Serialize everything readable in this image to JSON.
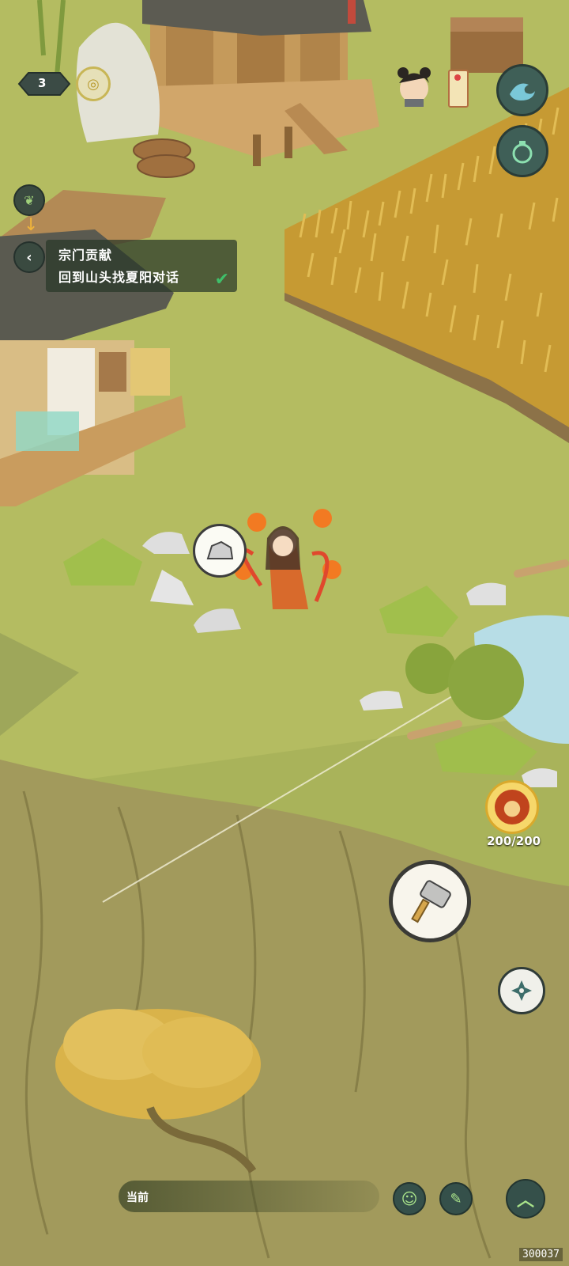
{
  "hud": {
    "level": "3",
    "stamina": "200/200"
  },
  "quest": {
    "title": "宗门贡献",
    "description": "回到山头找夏阳对话"
  },
  "chat": {
    "channel": "当前"
  },
  "version": "300037",
  "colors": {
    "grass": "#a9b35a",
    "cliff": "#a29a5c",
    "wheat": "#d2a73d",
    "water": "#b7dde6",
    "ui_dark": "#2e3b33",
    "ui_teal": "#3f8c86",
    "check": "#3fbf6a"
  },
  "icons": {
    "back": "chevron-left-icon",
    "wave": "wave-skill-icon",
    "pot": "gourd-icon",
    "map": "scroll-icon",
    "hammer": "hammer-tool-icon",
    "dodge": "shuriken-icon",
    "emoji": "smile-icon",
    "quick": "quick-chat-icon",
    "expand": "chevron-up-icon"
  }
}
